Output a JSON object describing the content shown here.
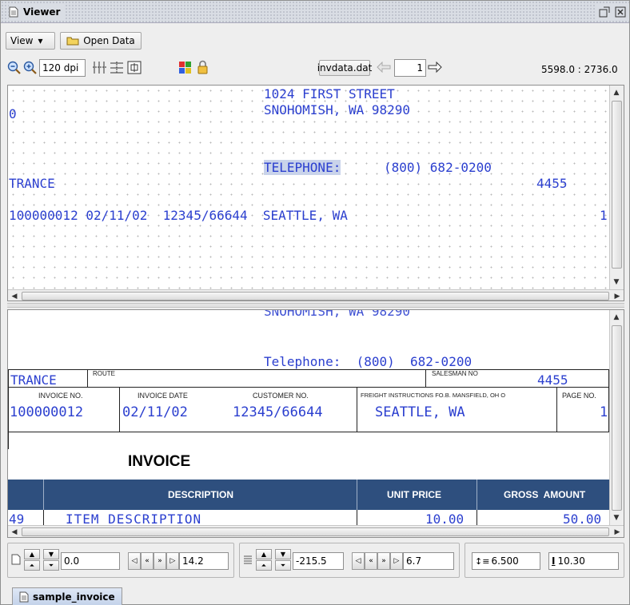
{
  "window": {
    "title": "Viewer"
  },
  "menu": {
    "view_label": "View",
    "open_data_label": "Open Data"
  },
  "toolbar": {
    "dpi_value": "120 dpi",
    "data_file": "invdata.dat",
    "page_value": "1",
    "coords": "5598.0 : 2736.0"
  },
  "data_view": {
    "lines": [
      "1024 FIRST STREET",
      "0",
      "SNOHOMISH, WA 98290",
      "TELEPHONE:",
      "(800) 682-0200",
      "TRANCE",
      "4455",
      "100000012 02/11/02  12345/66644  SEATTLE, WA",
      "1"
    ]
  },
  "form_view": {
    "telephone": "Telephone:  (800)  682-0200",
    "trance": "TRANCE",
    "route_label": "ROUTE",
    "salesman_label": "SALESMAN NO",
    "salesman_value": "4455",
    "headers": {
      "invoice_no": "INVOICE NO.",
      "invoice_date": "INVOICE DATE",
      "customer_no": "CUSTOMER NO.",
      "freight": "FREIGHT INSTRUCTIONS FO.B. MANSFIELD, OH O",
      "page_no": "PAGE NO."
    },
    "values": {
      "invoice_no": "100000012",
      "invoice_date": "02/11/02",
      "customer_no": "12345/66644",
      "freight": "SEATTLE, WA",
      "page_no": "1"
    },
    "invoice_title": "INVOICE",
    "columns": {
      "description": "DESCRIPTION",
      "unit_price": "UNIT PRICE",
      "gross_amount": "GROSS  AMOUNT"
    },
    "item": {
      "qty": "49",
      "description": "ITEM DESCRIPTION",
      "unit_price": "10.00",
      "gross_amount": "50.00"
    },
    "accent_color": "#2e4f7e"
  },
  "bottom": {
    "x_value": "0.0",
    "x_step": "14.2",
    "y_value": "-215.5",
    "y_step": "6.7",
    "line_spacing": "6.500",
    "char_size": "10.30"
  },
  "tabs": {
    "active_label": "sample_invoice"
  }
}
